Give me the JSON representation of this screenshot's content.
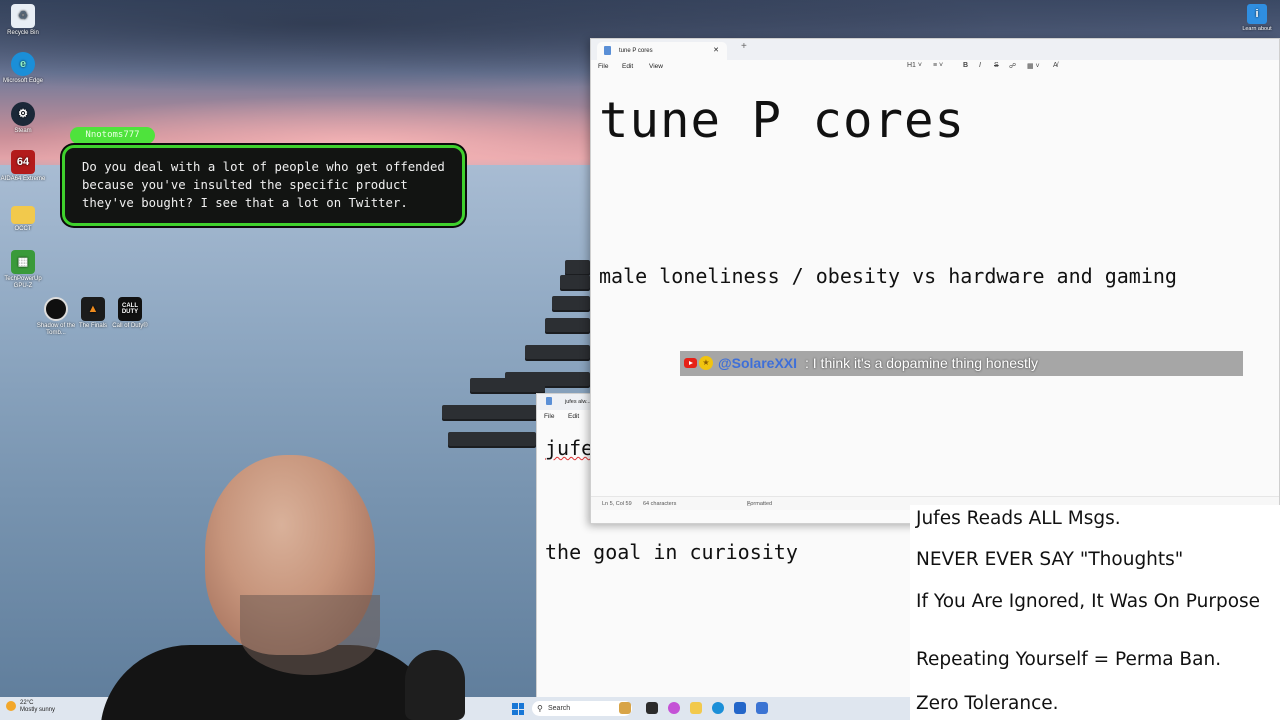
{
  "desktop": {
    "icons": [
      {
        "label": "Recycle Bin",
        "icon": "recycle-bin-icon"
      },
      {
        "label": "Microsoft Edge",
        "icon": "edge-icon"
      },
      {
        "label": "Steam",
        "icon": "steam-icon"
      },
      {
        "label": "AIDA64 Extreme",
        "icon": "aida64-icon"
      },
      {
        "label": "OCCT",
        "icon": "folder-icon"
      },
      {
        "label": "TechPowerUp GPU-Z",
        "icon": "gpuz-icon"
      },
      {
        "label": "Shadow of the Tomb...",
        "icon": "shadow-tomb-icon"
      },
      {
        "label": "The Finals",
        "icon": "the-finals-icon"
      },
      {
        "label": "Call of Duty®",
        "icon": "call-of-duty-icon"
      }
    ],
    "learn_about": "Learn about"
  },
  "chat_overlay": {
    "username": "Nnotoms777",
    "message": "Do you deal with a lot of people who get offended because you've insulted the specific product they've bought? I see that a lot on Twitter."
  },
  "notepad_main": {
    "tab_title": "tune P cores",
    "menu": [
      "File",
      "Edit",
      "View"
    ],
    "heading_tool": "H1",
    "title_text": "tune P cores",
    "line2_text": "male loneliness / obesity vs hardware and gaming",
    "status": {
      "position": "Ln 5, Col 59",
      "chars": "64 characters",
      "format": "Formatted"
    }
  },
  "notepad_second": {
    "tab_title": "jufes alw...",
    "menu": [
      "File",
      "Edit"
    ],
    "text1": "jufe",
    "text2": "the goal in curiosity"
  },
  "youtube_message": {
    "user": "@SolareXXI",
    "text": ": I think it's a dopamine thing honestly"
  },
  "rules": [
    "Jufes Reads ALL Msgs.",
    "NEVER EVER SAY \"Thoughts\"",
    "If You Are Ignored, It Was On Purpose",
    "Repeating Yourself = Perma Ban.",
    "Zero Tolerance."
  ],
  "taskbar": {
    "weather_temp": "22°C",
    "weather_desc": "Mostly sunny",
    "search_placeholder": "Search"
  },
  "colors": {
    "chat_accent": "#3fd12d",
    "youtube_user": "#3e6fd8",
    "windows_accent": "#1877d6"
  }
}
